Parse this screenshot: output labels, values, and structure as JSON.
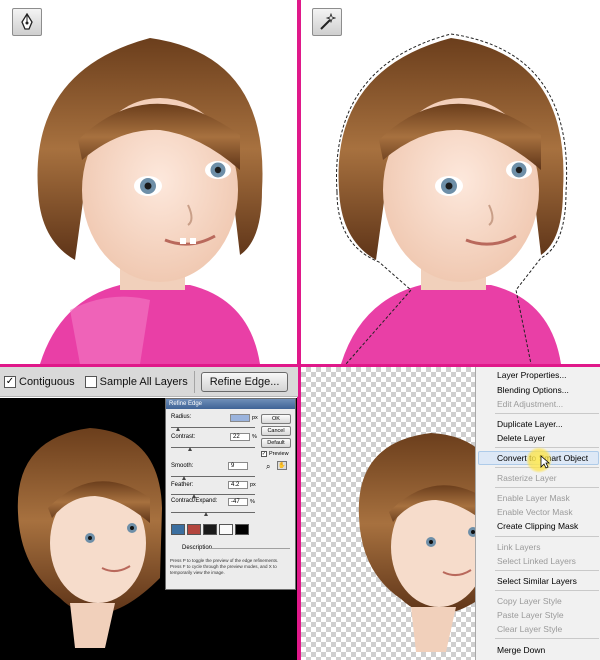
{
  "toolbar": {
    "contiguous_label": "Contiguous",
    "contiguous_checked": true,
    "sample_all_layers_label": "Sample All Layers",
    "sample_all_layers_checked": false,
    "refine_edge_label": "Refine Edge..."
  },
  "tools": {
    "top_left_icon": "pen-tool-icon",
    "top_right_icon": "magic-wand-icon"
  },
  "refine_dialog": {
    "title": "Refine Edge",
    "radius_label": "Radius:",
    "radius_unit": "px",
    "contrast_label": "Contrast:",
    "contrast_value": "22",
    "contrast_unit": "%",
    "smooth_label": "Smooth:",
    "smooth_value": "9",
    "feather_label": "Feather:",
    "feather_value": "4.2",
    "feather_unit": "px",
    "contract_label": "Contract/Expand:",
    "contract_value": "-47",
    "contract_unit": "%",
    "ok_label": "OK",
    "cancel_label": "Cancel",
    "default_label": "Default",
    "preview_label": "Preview",
    "preview_checked": true,
    "description_label": "Description",
    "description_text": "Press P to toggle the preview of the edge refinements. Press F to cycle through the preview modes, and X to temporarily view the image."
  },
  "context_menu": {
    "highlighted_index": 4,
    "items": [
      {
        "label": "Layer Properties...",
        "disabled": false
      },
      {
        "label": "Blending Options...",
        "disabled": false
      },
      {
        "label": "Edit Adjustment...",
        "disabled": true
      },
      {
        "label": "Duplicate Layer...",
        "disabled": false
      },
      {
        "label": "Delete Layer",
        "disabled": false
      },
      {
        "label": "Convert to Smart Object",
        "disabled": false
      },
      {
        "label": "Rasterize Layer",
        "disabled": true
      },
      {
        "label": "Enable Layer Mask",
        "disabled": true
      },
      {
        "label": "Enable Vector Mask",
        "disabled": true
      },
      {
        "label": "Create Clipping Mask",
        "disabled": false
      },
      {
        "label": "Link Layers",
        "disabled": true
      },
      {
        "label": "Select Linked Layers",
        "disabled": true
      },
      {
        "label": "Select Similar Layers",
        "disabled": false
      },
      {
        "label": "Copy Layer Style",
        "disabled": true
      },
      {
        "label": "Paste Layer Style",
        "disabled": true
      },
      {
        "label": "Clear Layer Style",
        "disabled": true
      },
      {
        "label": "Merge Down",
        "disabled": false
      }
    ]
  },
  "colors": {
    "divider": "#e0188a",
    "hair": "#8a5a2e",
    "skin": "#f6dccb",
    "shirt": "#e93fa6"
  }
}
